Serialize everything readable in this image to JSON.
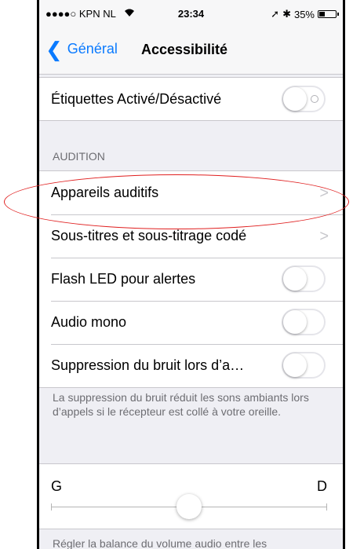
{
  "status_bar": {
    "carrier": "●●●●○ KPN NL",
    "time": "23:34",
    "battery_text": "35%",
    "battery_level": 0.35
  },
  "nav": {
    "back_label": "Général",
    "title": "Accessibilité"
  },
  "top_row": {
    "label": "Étiquettes Activé/Désactivé"
  },
  "audition": {
    "header": "AUDITION",
    "rows": [
      {
        "label": "Appareils auditifs"
      },
      {
        "label": "Sous-titres et sous-titrage codé"
      },
      {
        "label": "Flash LED pour alertes"
      },
      {
        "label": "Audio mono"
      },
      {
        "label": "Suppression du bruit lors d’a…"
      }
    ],
    "footer": "La suppression du bruit réduit les sons ambiants lors d’appels si le récepteur est collé à votre oreille."
  },
  "balance": {
    "left_label": "G",
    "right_label": "D",
    "value": 0.5,
    "footer": "Régler la balance du volume audio entre les"
  },
  "colors": {
    "accent": "#0a7aff",
    "annotation": "#e02020"
  }
}
